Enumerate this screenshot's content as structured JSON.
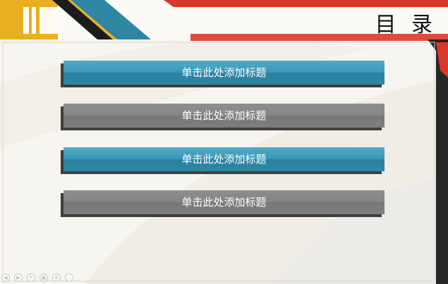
{
  "slide": {
    "title": "目 录",
    "toc_items": [
      {
        "label": "单击此处添加标题",
        "style": "teal"
      },
      {
        "label": "单击此处添加标题",
        "style": "gray"
      },
      {
        "label": "单击此处添加标题",
        "style": "teal"
      },
      {
        "label": "单击此处添加标题",
        "style": "gray"
      }
    ]
  },
  "colors": {
    "yellow": "#e8b020",
    "teal": "#2e86a3",
    "red": "#d8392b",
    "gray": "#808080",
    "dark": "#151515"
  },
  "controls": [
    {
      "icon": "previous-icon",
      "glyph": "◀"
    },
    {
      "icon": "next-icon",
      "glyph": "▶"
    },
    {
      "icon": "pen-icon",
      "glyph": "✎"
    },
    {
      "icon": "slides-icon",
      "glyph": "▣"
    },
    {
      "icon": "zoom-icon",
      "glyph": "⊕"
    },
    {
      "icon": "more-icon",
      "glyph": "…"
    }
  ]
}
